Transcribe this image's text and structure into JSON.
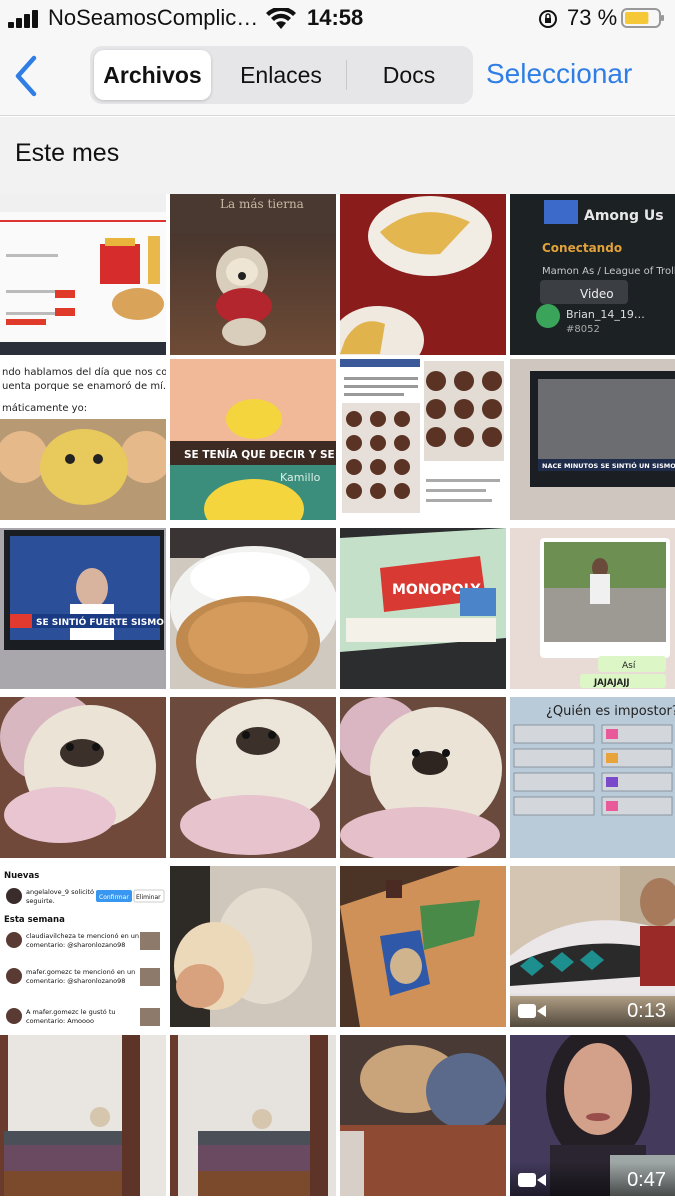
{
  "status_bar": {
    "carrier": "NoSeamosComplic…",
    "time": "14:58",
    "battery_percent": "73 %",
    "battery_level": 0.73,
    "battery_color": "#f5c838"
  },
  "nav": {
    "back_icon": "chevron-left-icon",
    "tabs": [
      {
        "label": "Archivos",
        "active": true
      },
      {
        "label": "Enlaces",
        "active": false
      },
      {
        "label": "Docs",
        "active": false
      }
    ],
    "select_label": "Seleccionar",
    "accent_color": "#2f7ee6"
  },
  "section": {
    "title": "Este mes"
  },
  "media": [
    {
      "caption": "",
      "kind": "image"
    },
    {
      "caption": "La más tierna",
      "kind": "image"
    },
    {
      "caption": "",
      "kind": "image"
    },
    {
      "caption": "Among Us · Conectando · Mamon As / League of Trolls · Video · Brian_14_19… · #8052",
      "kind": "image"
    },
    {
      "caption": "ndo hablamos del día que nos conocimos uenta porque se enamoró de mí. máticamente yo:",
      "kind": "image"
    },
    {
      "caption": "SE TENÍA QUE DECIR Y SE DIJO · Kamillo",
      "kind": "image"
    },
    {
      "caption": "",
      "kind": "image"
    },
    {
      "caption": "NACE MINUTOS SE SINTIÓ UN SISMO EN LIMA",
      "kind": "image"
    },
    {
      "caption": "SE SINTIÓ FUERTE SISMO",
      "kind": "image"
    },
    {
      "caption": "",
      "kind": "image"
    },
    {
      "caption": "MONOPOLY",
      "kind": "image"
    },
    {
      "caption": "Así · JAJAJAJJ",
      "kind": "image"
    },
    {
      "caption": "",
      "kind": "image"
    },
    {
      "caption": "",
      "kind": "image"
    },
    {
      "caption": "",
      "kind": "image"
    },
    {
      "caption": "¿Quién es impostor?",
      "kind": "image"
    },
    {
      "caption": "Nuevas · angelalove_9 solicitó seguirte. · Confirmar · Eliminar · Esta semana · claudiavilcheza te mencionó en un comentario: @sharonlozano98 · mafer.gomezc te mencionó en un comentario: @sharonlozano98 · A mafer.gomezc le gustó tu comentario: Amoooo",
      "kind": "image"
    },
    {
      "caption": "",
      "kind": "image"
    },
    {
      "caption": "",
      "kind": "image"
    },
    {
      "caption": "",
      "kind": "video",
      "duration": "0:13"
    },
    {
      "caption": "",
      "kind": "image"
    },
    {
      "caption": "",
      "kind": "image"
    },
    {
      "caption": "",
      "kind": "image"
    },
    {
      "caption": "",
      "kind": "video",
      "duration": "0:47"
    }
  ]
}
